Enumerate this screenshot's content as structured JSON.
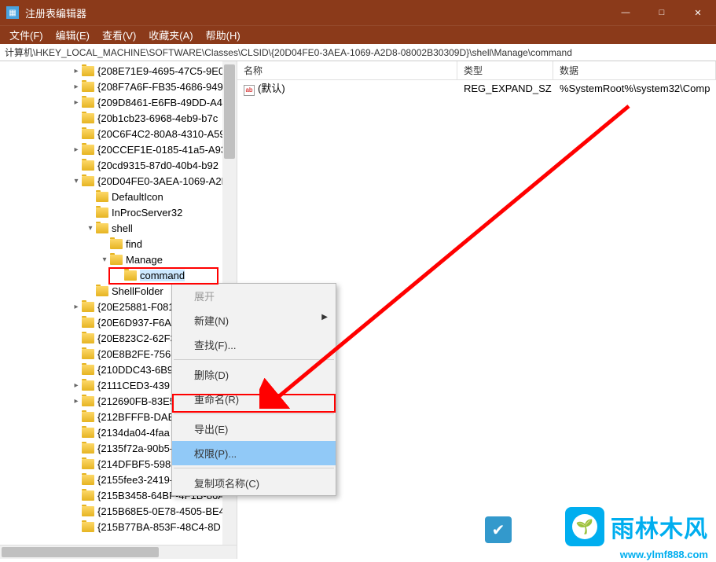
{
  "window": {
    "title": "注册表编辑器",
    "min": "—",
    "max": "□",
    "close": "✕"
  },
  "menu": {
    "file": "文件(F)",
    "edit": "编辑(E)",
    "view": "查看(V)",
    "favorites": "收藏夹(A)",
    "help": "帮助(H)"
  },
  "address": "计算机\\HKEY_LOCAL_MACHINE\\SOFTWARE\\Classes\\CLSID\\{20D04FE0-3AEA-1069-A2D8-08002B30309D}\\shell\\Manage\\command",
  "tree": [
    {
      "indent": 5,
      "exp": ">",
      "label": "{208E71E9-4695-47C5-9E0"
    },
    {
      "indent": 5,
      "exp": ">",
      "label": "{208F7A6F-FB35-4686-949"
    },
    {
      "indent": 5,
      "exp": ">",
      "label": "{209D8461-E6FB-49DD-A4"
    },
    {
      "indent": 5,
      "exp": "",
      "label": "{20b1cb23-6968-4eb9-b7c"
    },
    {
      "indent": 5,
      "exp": "",
      "label": "{20C6F4C2-80A8-4310-A59"
    },
    {
      "indent": 5,
      "exp": ">",
      "label": "{20CCEF1E-0185-41a5-A93"
    },
    {
      "indent": 5,
      "exp": "",
      "label": "{20cd9315-87d0-40b4-b92"
    },
    {
      "indent": 5,
      "exp": "v",
      "label": "{20D04FE0-3AEA-1069-A2D"
    },
    {
      "indent": 6,
      "exp": "",
      "label": "DefaultIcon"
    },
    {
      "indent": 6,
      "exp": "",
      "label": "InProcServer32"
    },
    {
      "indent": 6,
      "exp": "v",
      "label": "shell"
    },
    {
      "indent": 7,
      "exp": "",
      "label": "find"
    },
    {
      "indent": 7,
      "exp": "v",
      "label": "Manage"
    },
    {
      "indent": 8,
      "exp": "",
      "label": "command",
      "selected": true
    },
    {
      "indent": 6,
      "exp": "",
      "label": "ShellFolder"
    },
    {
      "indent": 5,
      "exp": ">",
      "label": "{20E25881-F081"
    },
    {
      "indent": 5,
      "exp": "",
      "label": "{20E6D937-F6A"
    },
    {
      "indent": 5,
      "exp": "",
      "label": "{20E823C2-62F3"
    },
    {
      "indent": 5,
      "exp": "",
      "label": "{20E8B2FE-7568"
    },
    {
      "indent": 5,
      "exp": "",
      "label": "{210DDC43-6B9"
    },
    {
      "indent": 5,
      "exp": ">",
      "label": "{2111CED3-439"
    },
    {
      "indent": 5,
      "exp": ">",
      "label": "{212690FB-83E5"
    },
    {
      "indent": 5,
      "exp": "",
      "label": "{212BFFFB-DAB"
    },
    {
      "indent": 5,
      "exp": "",
      "label": "{2134da04-4faa"
    },
    {
      "indent": 5,
      "exp": "",
      "label": "{2135f72a-90b5-4ed3-a7f"
    },
    {
      "indent": 5,
      "exp": "",
      "label": "{214DFBF5-5983-4B54-996"
    },
    {
      "indent": 5,
      "exp": "",
      "label": "{2155fee3-2419-4373-b10"
    },
    {
      "indent": 5,
      "exp": "",
      "label": "{215B3458-64BF-4F1B-86A"
    },
    {
      "indent": 5,
      "exp": "",
      "label": "{215B68E5-0E78-4505-BE4"
    },
    {
      "indent": 5,
      "exp": "",
      "label": "{215B77BA-853F-48C4-8D"
    }
  ],
  "list": {
    "columns": {
      "name": "名称",
      "type": "类型",
      "data": "数据"
    },
    "rows": [
      {
        "name": "(默认)",
        "type": "REG_EXPAND_SZ",
        "data": "%SystemRoot%\\system32\\Comp"
      }
    ]
  },
  "contextMenu": {
    "expand": "展开",
    "new": "新建(N)",
    "find": "查找(F)...",
    "delete": "删除(D)",
    "rename": "重命名(R)",
    "export": "导出(E)",
    "permissions": "权限(P)...",
    "copyKeyName": "复制项名称(C)"
  },
  "watermark": {
    "text": "雨林木风",
    "url": "www.ylmf888.com"
  }
}
